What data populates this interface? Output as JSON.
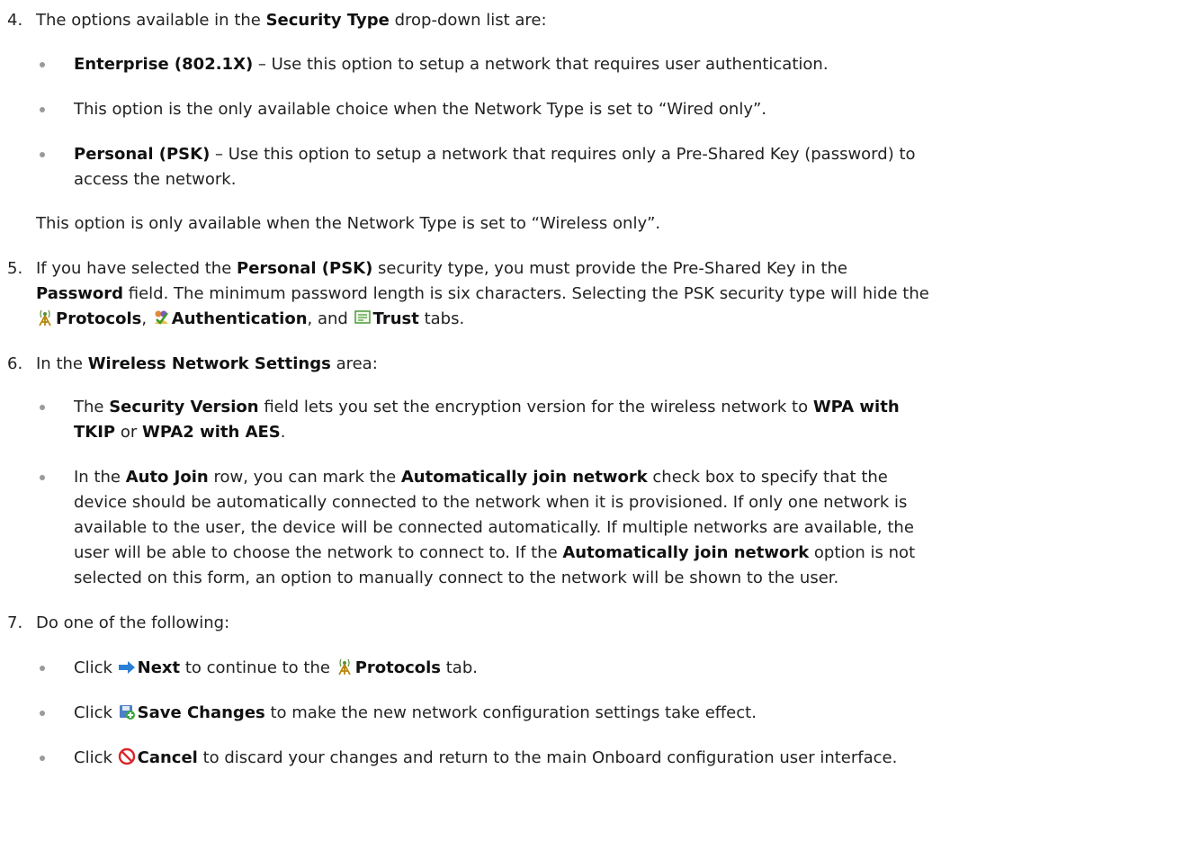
{
  "steps": {
    "s4": {
      "number": "4.",
      "intro_pre": "The options available in the ",
      "intro_bold": "Security Type",
      "intro_post": " drop-down list are:",
      "b1_bold": "Enterprise (802.1X)",
      "b1_text": " – Use this option to setup a network that requires user authentication.",
      "b2_text": "This option is the only available choice when the Network Type is set to “Wired only”.",
      "b3_bold": "Personal (PSK)",
      "b3_text_1": " – Use this option to setup a network that requires only a Pre-Shared Key (password) to",
      "b3_text_2": "access the network.",
      "note": "This option is only available when the Network Type is set to “Wireless only”."
    },
    "s5": {
      "number": "5.",
      "p1_pre": "If you have selected the ",
      "p1_bold": "Personal (PSK)",
      "p1_post": " security type, you must provide the Pre-Shared Key in the",
      "p2_bold": "Password",
      "p2_post": " field. The minimum password length is six characters. Selecting the PSK security type will hide the",
      "p3_protocols": "Protocols",
      "p3_sep1": ", ",
      "p3_auth": "Authentication",
      "p3_sep2": ", and ",
      "p3_trust": "Trust",
      "p3_post": " tabs."
    },
    "s6": {
      "number": "6.",
      "intro_pre": "In the ",
      "intro_bold": "Wireless Network Settings",
      "intro_post": " area:",
      "b1_pre": "The ",
      "b1_bold1": "Security Version",
      "b1_mid": " field lets you set the encryption version for the wireless network to ",
      "b1_bold2a": "WPA with",
      "b1_bold2b": "TKIP",
      "b1_or": " or ",
      "b1_bold3": "WPA2 with AES",
      "b1_end": ".",
      "b2_pre": "In the ",
      "b2_bold1": "Auto Join",
      "b2_mid": " row, you can mark the ",
      "b2_bold2": "Automatically join network",
      "b2_post": " check box to specify that the",
      "b2_l2": "device should be automatically connected to the network when it is provisioned. If only one network is",
      "b2_l3": "available to the user, the device will be connected automatically. If multiple networks are available, the",
      "b2_l4_pre": "user will be able to choose the network to connect to. If the ",
      "b2_l4_bold": "Automatically join network",
      "b2_l4_post": " option is not",
      "b2_l5": "selected on this form, an option to manually connect to the network will be shown to the user."
    },
    "s7": {
      "number": "7.",
      "intro": "Do one of the following:",
      "b1_click": "Click ",
      "b1_bold": "Next",
      "b1_mid": " to continue to the ",
      "b1_bold2": "Protocols",
      "b1_post": " tab.",
      "b2_click": "Click ",
      "b2_bold": "Save Changes",
      "b2_post": " to make the new network configuration settings take effect.",
      "b3_click": "Click ",
      "b3_bold": "Cancel",
      "b3_post": " to discard your changes and return to the main Onboard configuration user interface."
    }
  },
  "icons": {
    "protocols": "antenna-icon",
    "authentication": "users-check-icon",
    "trust": "certificate-icon",
    "next": "arrow-right-icon",
    "save": "save-disk-icon",
    "cancel": "cancel-circle-icon"
  },
  "colors": {
    "text": "#222222",
    "bullet": "#9a9a9a",
    "cancel": "#d9262c",
    "next": "#2a7fd6"
  }
}
